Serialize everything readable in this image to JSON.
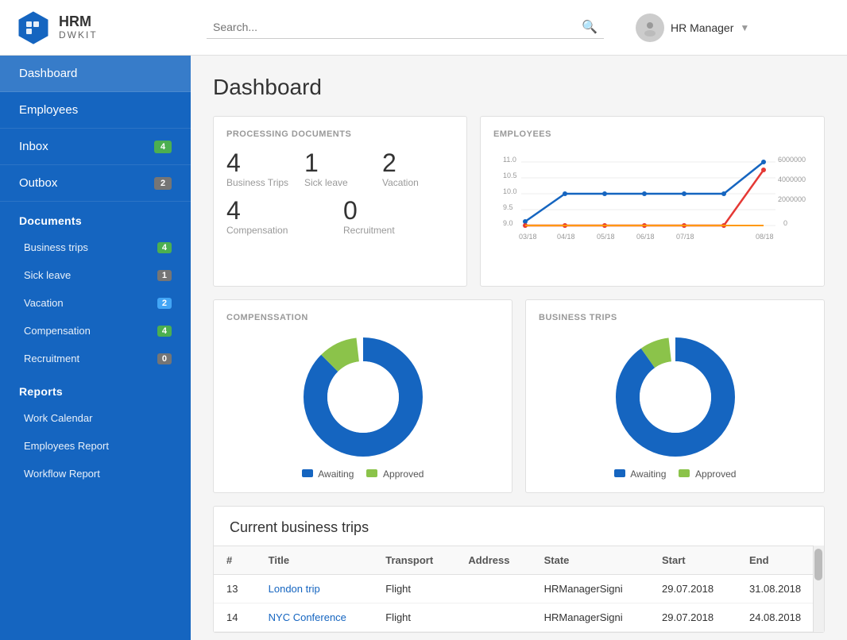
{
  "app": {
    "name": "HRM",
    "sub": "DWKIT"
  },
  "topnav": {
    "search_placeholder": "Search...",
    "user_name": "HR Manager"
  },
  "sidebar": {
    "dashboard_label": "Dashboard",
    "employees_label": "Employees",
    "inbox_label": "Inbox",
    "inbox_badge": "4",
    "outbox_label": "Outbox",
    "outbox_badge": "2",
    "documents_header": "Documents",
    "documents_items": [
      {
        "label": "Business trips",
        "badge": "4",
        "badge_color": "green"
      },
      {
        "label": "Sick leave",
        "badge": "1",
        "badge_color": "grey"
      },
      {
        "label": "Vacation",
        "badge": "2",
        "badge_color": "blue"
      },
      {
        "label": "Compensation",
        "badge": "4",
        "badge_color": "green"
      },
      {
        "label": "Recruitment",
        "badge": "0",
        "badge_color": "grey"
      }
    ],
    "reports_header": "Reports",
    "reports_items": [
      {
        "label": "Work Calendar"
      },
      {
        "label": "Employees Report"
      },
      {
        "label": "Workflow Report"
      }
    ]
  },
  "main": {
    "page_title": "Dashboard",
    "proc_docs": {
      "section_title": "PROCESSING DOCUMENTS",
      "items_row1": [
        {
          "num": "4",
          "label": "Business Trips"
        },
        {
          "num": "1",
          "label": "Sick leave"
        },
        {
          "num": "2",
          "label": "Vacation"
        }
      ],
      "items_row2": [
        {
          "num": "4",
          "label": "Compensation"
        },
        {
          "num": "0",
          "label": "Recruitment"
        }
      ]
    },
    "employees_chart": {
      "section_title": "EMPLOYEES"
    },
    "compenssation_donut": {
      "title": "COMPENSSATION",
      "legend_awaiting": "Awaiting",
      "legend_approved": "Approved"
    },
    "business_trips_donut": {
      "title": "BUSINESS TRIPS",
      "legend_awaiting": "Awaiting",
      "legend_approved": "Approved"
    },
    "current_trips": {
      "title": "Current business trips",
      "columns": [
        "#",
        "Title",
        "Transport",
        "Address",
        "State",
        "Start",
        "End"
      ],
      "rows": [
        {
          "id": "13",
          "title": "London trip",
          "transport": "Flight",
          "address": "",
          "state": "HRManagerSigni",
          "start": "29.07.2018",
          "end": "31.08.2018"
        },
        {
          "id": "14",
          "title": "NYC Conference",
          "transport": "Flight",
          "address": "",
          "state": "HRManagerSigni",
          "start": "29.07.2018",
          "end": "24.08.2018"
        }
      ]
    }
  }
}
